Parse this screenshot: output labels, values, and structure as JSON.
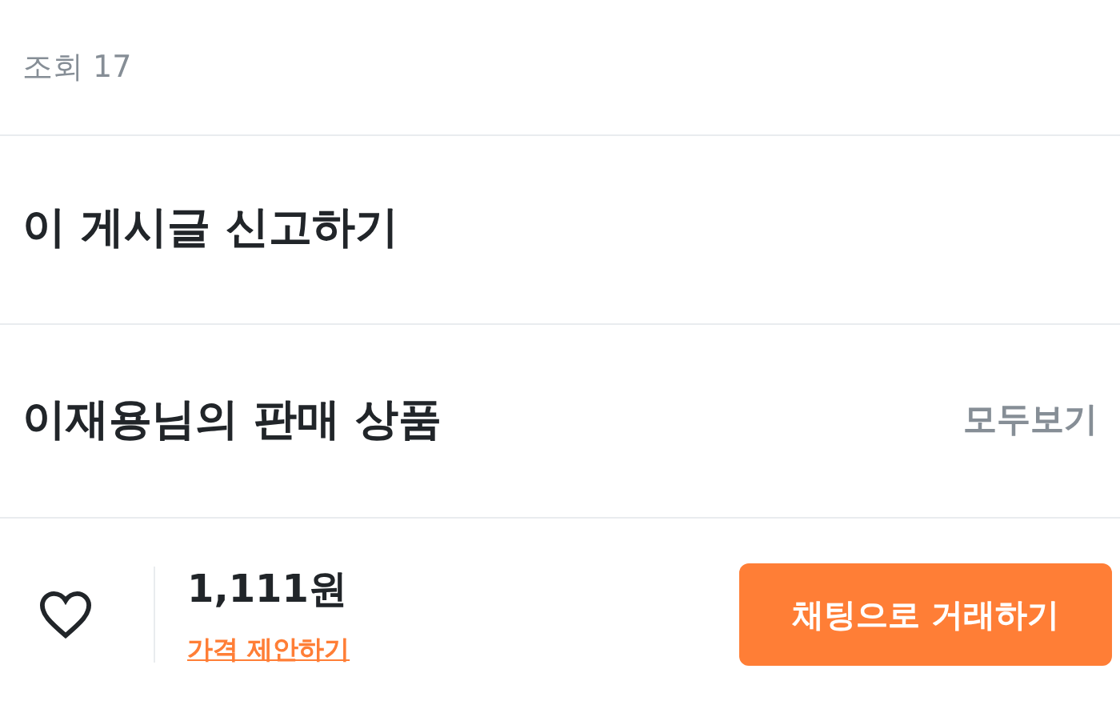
{
  "views": "조회 17",
  "report": {
    "label": "이 게시글 신고하기"
  },
  "seller_products": {
    "title": "이재용님의 판매 상품",
    "see_all": "모두보기"
  },
  "bottom_bar": {
    "liked": false,
    "price": "1,111원",
    "offer_link": "가격 제안하기",
    "chat_button": "채팅으로 거래하기"
  }
}
